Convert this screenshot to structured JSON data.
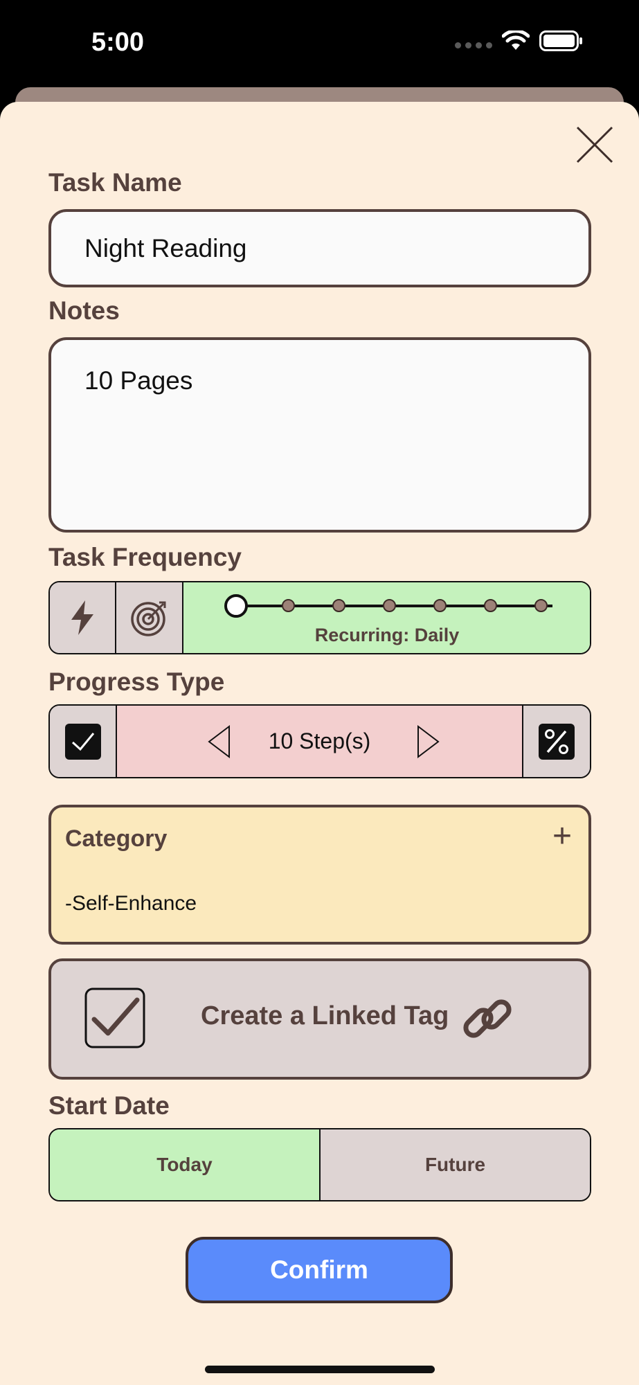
{
  "status_bar": {
    "time": "5:00"
  },
  "task_name": {
    "label": "Task Name",
    "value": "Night Reading"
  },
  "notes": {
    "label": "Notes",
    "value": "10 Pages"
  },
  "frequency": {
    "label": "Task Frequency",
    "options": [
      "lightning-icon",
      "target-icon"
    ],
    "slider_label": "Recurring: Daily",
    "slider_position": 0,
    "slider_stops": 7,
    "active_color": "#c5f2bd"
  },
  "progress": {
    "label": "Progress Type",
    "steps_label": "10 Step(s)",
    "active_color": "#f3cfcf"
  },
  "category": {
    "label": "Category",
    "add": "+",
    "value": "-Self-Enhance"
  },
  "linked_tag": {
    "label": "Create a Linked Tag",
    "checked": true
  },
  "start_date": {
    "label": "Start Date",
    "today": "Today",
    "future": "Future",
    "selected": "Today"
  },
  "confirm": {
    "label": "Confirm"
  },
  "colors": {
    "background": "#fdeedd",
    "accent_green": "#c5f2bd",
    "confirm_blue": "#5a8bfb",
    "text_brown": "#55413d"
  }
}
